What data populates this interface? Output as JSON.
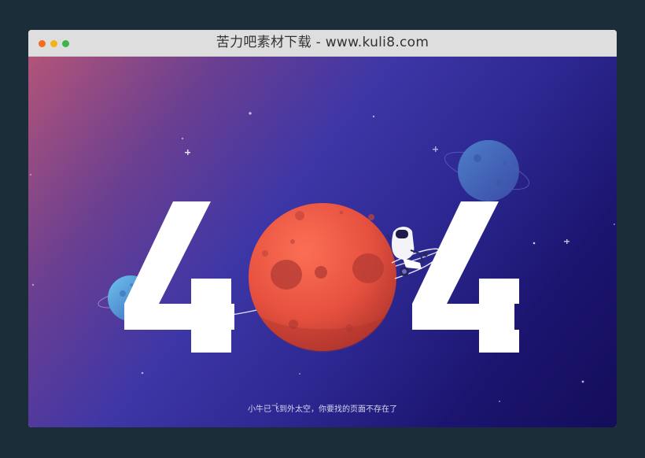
{
  "window": {
    "title": "苦力吧素材下载 - www.kuli8.com",
    "controls": {
      "close_color": "#f46b22",
      "minimize_color": "#f3b41b",
      "maximize_color": "#3db549"
    }
  },
  "error_page": {
    "digit_left": "4",
    "digit_right": "4",
    "message": "小牛已飞到外太空，你要找的页面不存在了",
    "colors": {
      "background_start": "#b25478",
      "background_mid": "#3d36a6",
      "background_end": "#140d5a",
      "digits": "#ffffff",
      "red_planet": "#e2523e",
      "blue_planet_small": "#4aa0d8",
      "blue_planet_large": "#3d6fc0"
    },
    "icons": [
      "red-planet-icon",
      "small-blue-planet-icon",
      "large-blue-planet-icon",
      "astronaut-icon",
      "star-icon"
    ]
  }
}
